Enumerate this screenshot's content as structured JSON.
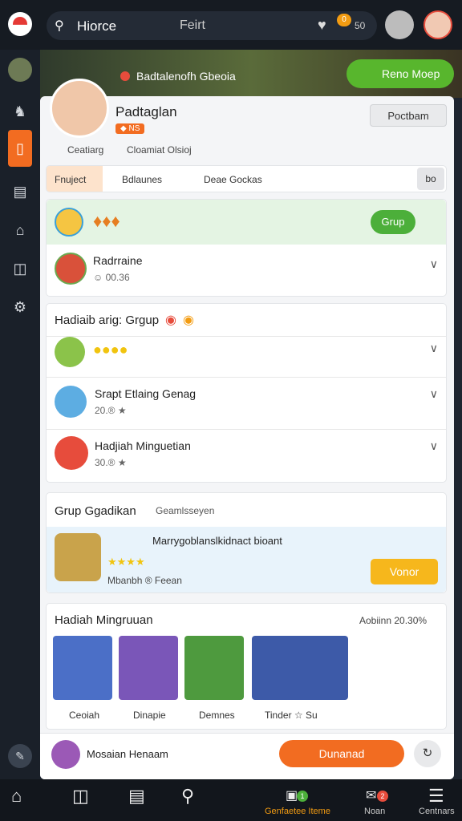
{
  "topbar": {
    "search_placeholder_label": "Hiorce",
    "search_query": "Feirt",
    "notification_badge": "0",
    "notification_count": "50"
  },
  "banner": {
    "notice": "Badtalenofh Gbeoia",
    "lobby_button": "Reno Moep"
  },
  "profile": {
    "name": "Padtaglan",
    "tag": "◆ NS",
    "stat_1": "Ceatiarg",
    "stat_2": "Cloamiat Olsioj",
    "button": "Poctbam"
  },
  "tabs": {
    "items": [
      "Fnuject",
      "Bdlaunes",
      "Deae Gockas"
    ],
    "more": "bo"
  },
  "group_row": {
    "button": "Grup"
  },
  "user_row_1": {
    "name": "Radrraine",
    "meta": "☺ 00.36"
  },
  "section_2": {
    "title": "Hadiaib arig: Grgup",
    "rows": [
      {
        "name": "",
        "meta": ""
      },
      {
        "name": "Srapt Etlaing Genag",
        "meta": "20.® ★"
      },
      {
        "name": "Hadjiah Minguetian",
        "meta": "30.® ★"
      }
    ]
  },
  "section_3": {
    "title": "Grup Ggadikan",
    "subtitle": "Geamlsseyen",
    "promo_title": "Marrygoblanslkidnact bioant",
    "promo_sub": "Mbanbh ® Feean",
    "promo_button": "Vonor"
  },
  "section_4": {
    "title": "Hadiah Mingruuan",
    "right_label": "Aobiinn 20.30%",
    "tabs": [
      "Ceoiah",
      "Dinapie",
      "Demnes",
      "Tinder ☆ Su"
    ]
  },
  "footer_action": {
    "name": "Mosaian Henaam",
    "button": "Dunanad"
  },
  "bottom_nav": {
    "items": [
      "",
      "",
      "",
      "",
      "Genfaetee Iteme",
      "Noan",
      "Centnars"
    ],
    "badge_1": "1",
    "badge_2": "2"
  },
  "colors": {
    "accent_orange": "#f26c21",
    "green": "#58b62d",
    "dark_bg": "#1e2530"
  }
}
